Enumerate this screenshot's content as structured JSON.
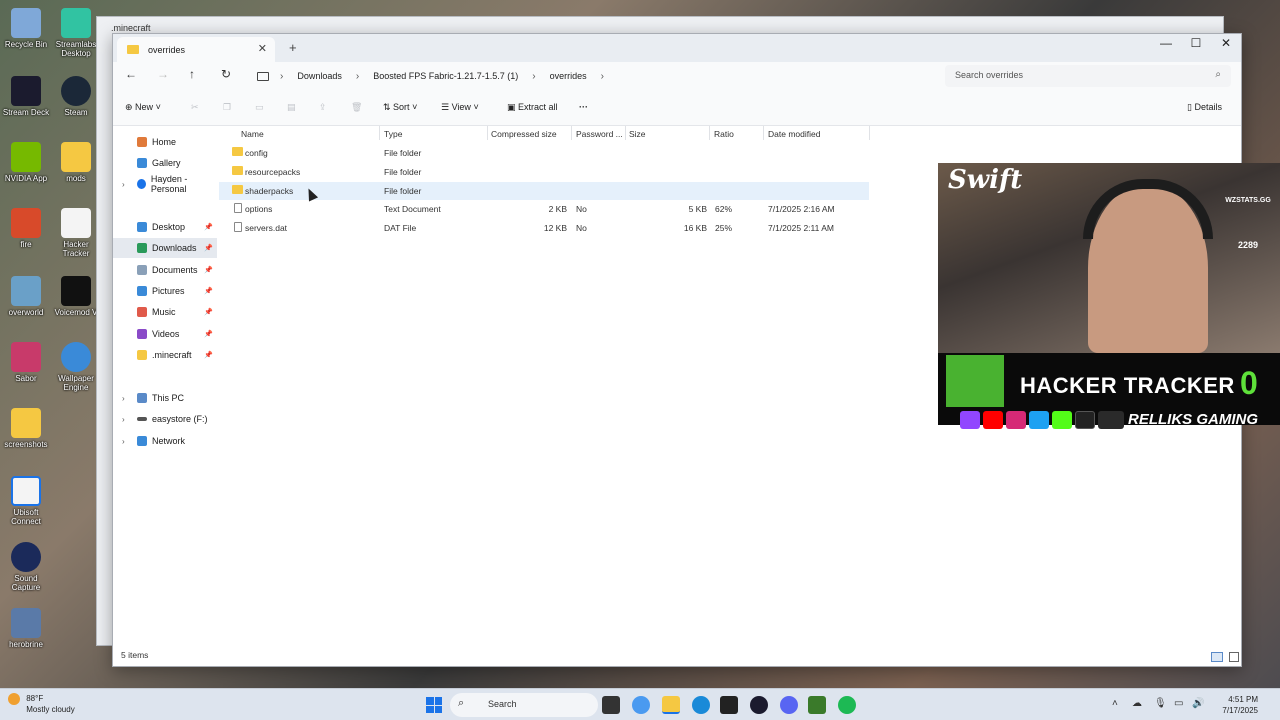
{
  "desktop": {
    "icons": [
      {
        "label": "Recycle Bin"
      },
      {
        "label": "Streamlabs Desktop"
      },
      {
        "label": "Stream Deck"
      },
      {
        "label": "Steam"
      },
      {
        "label": "NVIDIA App"
      },
      {
        "label": "mods"
      },
      {
        "label": "fire"
      },
      {
        "label": "Hacker Tracker"
      },
      {
        "label": "overworld"
      },
      {
        "label": "Voicemod V"
      },
      {
        "label": "Sabor"
      },
      {
        "label": "Wallpaper Engine"
      },
      {
        "label": "screenshots"
      },
      {
        "label": "Ubisoft Connect"
      },
      {
        "label": "Sound Capture"
      },
      {
        "label": "herobrine"
      }
    ]
  },
  "background_window": {
    "tab": ".minecraft"
  },
  "explorer": {
    "tab_title": "overrides",
    "breadcrumbs": [
      "Downloads",
      "Boosted FPS Fabric-1.21.7-1.5.7 (1)",
      "overrides"
    ],
    "search_placeholder": "Search overrides",
    "toolbar": {
      "new": "New",
      "sort": "Sort",
      "view": "View",
      "extract_all": "Extract all",
      "more": "···",
      "details": "Details"
    },
    "nav": {
      "home": "Home",
      "gallery": "Gallery",
      "personal": "Hayden - Personal",
      "desktop": "Desktop",
      "downloads": "Downloads",
      "documents": "Documents",
      "pictures": "Pictures",
      "music": "Music",
      "videos": "Videos",
      "minecraft": ".minecraft",
      "this_pc": "This PC",
      "easystore": "easystore (F:)",
      "network": "Network"
    },
    "columns": {
      "name": "Name",
      "type": "Type",
      "compressed": "Compressed size",
      "password": "Password ...",
      "size": "Size",
      "ratio": "Ratio",
      "modified": "Date modified"
    },
    "files": [
      {
        "name": "config",
        "type": "File folder",
        "compressed": "",
        "password": "",
        "size": "",
        "ratio": "",
        "modified": ""
      },
      {
        "name": "resourcepacks",
        "type": "File folder",
        "compressed": "",
        "password": "",
        "size": "",
        "ratio": "",
        "modified": ""
      },
      {
        "name": "shaderpacks",
        "type": "File folder",
        "compressed": "",
        "password": "",
        "size": "",
        "ratio": "",
        "modified": ""
      },
      {
        "name": "options",
        "type": "Text Document",
        "compressed": "2 KB",
        "password": "No",
        "size": "5 KB",
        "ratio": "62%",
        "modified": "7/1/2025 2:16 AM"
      },
      {
        "name": "servers.dat",
        "type": "DAT File",
        "compressed": "12 KB",
        "password": "No",
        "size": "16 KB",
        "ratio": "25%",
        "modified": "7/1/2025 2:11 AM"
      }
    ],
    "status": "5 items"
  },
  "overlay": {
    "cam_text": "Swift",
    "badge_site": "WZSTATS.GG",
    "badge_rank": "2289",
    "tracker_title": "HACKER TRACKER",
    "tracker_count": "0",
    "brand": "RELLIKS GAMING"
  },
  "taskbar": {
    "temp": "88°F",
    "weather": "Mostly cloudy",
    "search": "Search",
    "time": "4:51 PM",
    "date": "7/17/2025"
  }
}
